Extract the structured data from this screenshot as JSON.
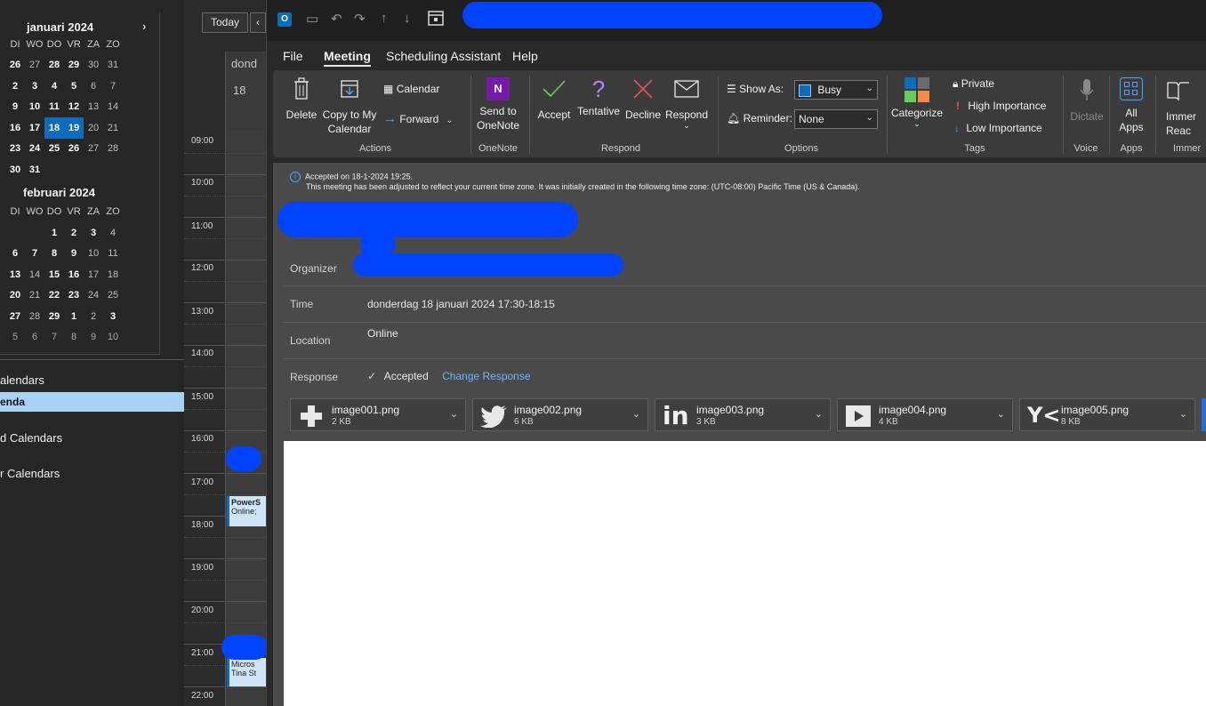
{
  "calendar": {
    "jan": {
      "title": "januari 2024",
      "next": "›",
      "headers": [
        "DI",
        "WO",
        "DO",
        "VR",
        "ZA",
        "ZO"
      ],
      "rows": [
        [
          "26",
          "27",
          "28",
          "29",
          "30",
          "31"
        ],
        [
          "2",
          "3",
          "4",
          "5",
          "6",
          "7"
        ],
        [
          "9",
          "10",
          "11",
          "12",
          "13",
          "14"
        ],
        [
          "16",
          "17",
          "18",
          "19",
          "20",
          "21"
        ],
        [
          "23",
          "24",
          "25",
          "26",
          "27",
          "28"
        ],
        [
          "30",
          "31",
          "",
          "",
          "",
          ""
        ]
      ]
    },
    "feb": {
      "title": "februari 2024",
      "headers": [
        "DI",
        "WO",
        "DO",
        "VR",
        "ZA",
        "ZO"
      ],
      "rows": [
        [
          "",
          "",
          "1",
          "2",
          "3",
          "4"
        ],
        [
          "6",
          "7",
          "8",
          "9",
          "10",
          "11"
        ],
        [
          "13",
          "14",
          "15",
          "16",
          "17",
          "18"
        ],
        [
          "20",
          "21",
          "22",
          "23",
          "24",
          "25"
        ],
        [
          "27",
          "28",
          "29",
          "1",
          "2",
          "3"
        ],
        [
          "5",
          "6",
          "7",
          "8",
          "9",
          "10"
        ]
      ]
    }
  },
  "nav": {
    "my_calendars": "alendars",
    "agenda": "enda",
    "shared_calendars": "d Calendars",
    "other_calendars": "r Calendars"
  },
  "dayview": {
    "today": "Today",
    "prev": "‹",
    "day_name": "dond",
    "day_num": "18",
    "hours": [
      "09:00",
      "10:00",
      "11:00",
      "12:00",
      "13:00",
      "14:00",
      "15:00",
      "16:00",
      "17:00",
      "18:00",
      "19:00",
      "20:00",
      "21:00",
      "22:00"
    ],
    "appt1": {
      "line1": "PowerS",
      "line2": "Online;"
    },
    "appt2": {
      "line1": "Micros",
      "line2": "Tina St"
    }
  },
  "menu": {
    "file": "File",
    "meeting": "Meeting",
    "scheduling": "Scheduling Assistant",
    "help": "Help"
  },
  "ribbon": {
    "delete": "Delete",
    "copy_to_my_calendar_1": "Copy to My",
    "copy_to_my_calendar_2": "Calendar",
    "calendar": "Calendar",
    "forward": "Forward",
    "actions": "Actions",
    "send_to_onenote_1": "Send to",
    "send_to_onenote_2": "OneNote",
    "onenote": "OneNote",
    "accept": "Accept",
    "tentative": "Tentative",
    "decline": "Decline",
    "respond": "Respond",
    "respond_group": "Respond",
    "show_as": "Show As:",
    "show_as_value": "Busy",
    "reminder": "Reminder:",
    "reminder_value": "None",
    "options": "Options",
    "categorize": "Categorize",
    "private": "Private",
    "high_importance": "High Importance",
    "low_importance": "Low Importance",
    "tags": "Tags",
    "dictate": "Dictate",
    "voice": "Voice",
    "all_apps_1": "All",
    "all_apps_2": "Apps",
    "apps": "Apps",
    "immersive_1": "Immer",
    "immersive_2": "Reac",
    "immersive_group": "Immer"
  },
  "meeting": {
    "accepted_on": "Accepted on 18-1-2024 19:25.",
    "timezone_note": "This meeting has been adjusted to reflect your current time zone. It was initially created in the following time zone: (UTC-08:00) Pacific Time (US & Canada).",
    "organizer_label": "Organizer",
    "time_label": "Time",
    "time_value": "donderdag 18 januari 2024 17:30-18:15",
    "location_label": "Location",
    "location_value": "Online",
    "response_label": "Response",
    "response_value": "Accepted",
    "change_response": "Change Response"
  },
  "attachments": [
    {
      "name": "image001.png",
      "size": "2 KB",
      "icon": "plus-icon"
    },
    {
      "name": "image002.png",
      "size": "6 KB",
      "icon": "twitter-icon"
    },
    {
      "name": "image003.png",
      "size": "3 KB",
      "icon": "linkedin-icon"
    },
    {
      "name": "image004.png",
      "size": "4 KB",
      "icon": "play-icon"
    },
    {
      "name": "image005.png",
      "size": "8 KB",
      "icon": "yammer-icon"
    }
  ],
  "colors": {
    "accent": "#0f6cbd",
    "redaction": "#0044ff",
    "link": "#72b4ff"
  }
}
